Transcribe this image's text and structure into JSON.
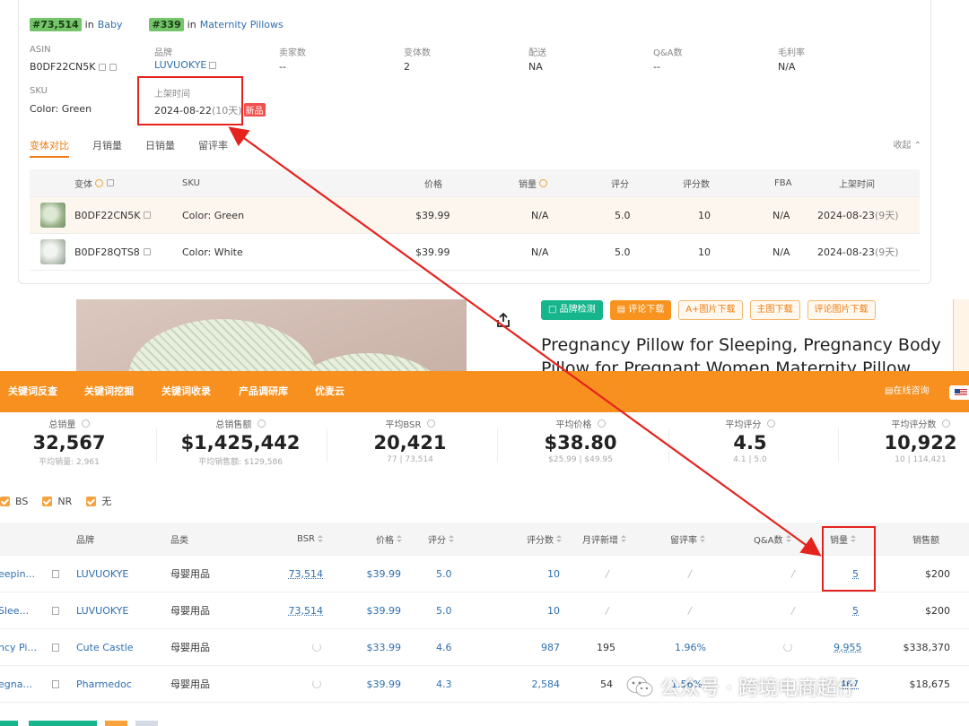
{
  "rank": [
    {
      "badge": "#73,514",
      "in": "in",
      "category": "Baby"
    },
    {
      "badge": "#339",
      "in": "in",
      "category": "Maternity Pillows"
    }
  ],
  "info": {
    "asin_label": "ASIN",
    "asin_value": "B0DF22CN5K",
    "brand_label": "品牌",
    "brand_value": "LUVUOKYE",
    "sellers_label": "卖家数",
    "sellers_value": "--",
    "variants_label": "变体数",
    "variants_value": "2",
    "delivery_label": "配送",
    "delivery_value": "NA",
    "qa_label": "Q&A数",
    "qa_value": "--",
    "margin_label": "毛利率",
    "margin_value": "N/A",
    "sku_label": "SKU",
    "sku_value": "Color: Green",
    "listed_label": "上架时间",
    "listed_date": "2024-08-22",
    "listed_age": "(10天)",
    "new_badge": "新品"
  },
  "tabs": {
    "items": [
      "变体对比",
      "月销量",
      "日销量",
      "留评率"
    ],
    "collapse": "收起"
  },
  "variant_table": {
    "headers": {
      "variant": "变体",
      "sku": "SKU",
      "price": "价格",
      "sales": "销量",
      "rating": "评分",
      "reviews": "评分数",
      "fba": "FBA",
      "listed": "上架时间"
    },
    "rows": [
      {
        "asin": "B0DF22CN5K",
        "sku": "Color: Green",
        "price": "$39.99",
        "sales": "N/A",
        "rating": "5.0",
        "reviews": "10",
        "fba": "N/A",
        "listed": "2024-08-23",
        "age": "(9天)"
      },
      {
        "asin": "B0DF28QTS8",
        "sku": "Color: White",
        "price": "$39.99",
        "sales": "N/A",
        "rating": "5.0",
        "reviews": "10",
        "fba": "N/A",
        "listed": "2024-08-23",
        "age": "(9天)"
      }
    ]
  },
  "product": {
    "buttons": [
      "品牌检测",
      "评论下载",
      "A+图片下载",
      "主图下载",
      "评论图片下载"
    ],
    "title": "Pregnancy Pillow for Sleeping, Pregnancy Body Pillow for Pregnant Women Maternity Pillow"
  },
  "toolbar": {
    "items": [
      "关键词反查",
      "关键词挖掘",
      "关键词收录",
      "产品调研库",
      "优麦云"
    ],
    "support": "在线咨询"
  },
  "stats": [
    {
      "label": "总销量",
      "value": "32,567",
      "sub": "平均销量: 2,961"
    },
    {
      "label": "总销售额",
      "value": "$1,425,442",
      "sub": "平均销售额: $129,586"
    },
    {
      "label": "平均BSR",
      "value": "20,421",
      "sub": "77 | 73,514"
    },
    {
      "label": "平均价格",
      "value": "$38.80",
      "sub": "$25.99 | $49.95"
    },
    {
      "label": "平均评分",
      "value": "4.5",
      "sub": "4.1 | 5.0"
    },
    {
      "label": "平均评分数",
      "value": "10,922",
      "sub": "10 | 114,421"
    }
  ],
  "filters": [
    "BS",
    "NR",
    "无"
  ],
  "result_table": {
    "headers": {
      "brand": "品牌",
      "category": "品类",
      "bsr": "BSR",
      "price": "价格",
      "rating": "评分",
      "reviews": "评分数",
      "monthly_new": "月评新增",
      "review_rate": "留评率",
      "qa": "Q&A数",
      "sales": "销量",
      "revenue": "销售额"
    },
    "rows": [
      {
        "title": "eepin...",
        "brand": "LUVUOKYE",
        "category": "母婴用品",
        "bsr": "73,514",
        "price": "$39.99",
        "rating": "5.0",
        "reviews": "10",
        "monthly_new": "/",
        "review_rate": "/",
        "qa": "/",
        "sales": "5",
        "revenue": "$200"
      },
      {
        "title": "Slee...",
        "brand": "LUVUOKYE",
        "category": "母婴用品",
        "bsr": "73,514",
        "price": "$39.99",
        "rating": "5.0",
        "reviews": "10",
        "monthly_new": "/",
        "review_rate": "/",
        "qa": "/",
        "sales": "5",
        "revenue": "$200"
      },
      {
        "title": "ncy Pi...",
        "brand": "Cute Castle",
        "category": "母婴用品",
        "bsr": "",
        "price": "$33.99",
        "rating": "4.6",
        "reviews": "987",
        "monthly_new": "195",
        "review_rate": "1.96%",
        "qa": "",
        "sales": "9,955",
        "revenue": "$338,370"
      },
      {
        "title": "egna...",
        "brand": "Pharmedoc",
        "category": "母婴用品",
        "bsr": "",
        "price": "$39.99",
        "rating": "4.3",
        "reviews": "2,584",
        "monthly_new": "54",
        "review_rate": "1.56%",
        "qa": "",
        "sales": "467",
        "revenue": "$18,675"
      }
    ]
  },
  "watermark": {
    "text": "公众号 · 跨境电商超仔"
  },
  "colors": {
    "accent": "#f7901e",
    "link": "#2f6fb0",
    "annotation": "#e5231e",
    "rank_badge": "#74c46a"
  }
}
